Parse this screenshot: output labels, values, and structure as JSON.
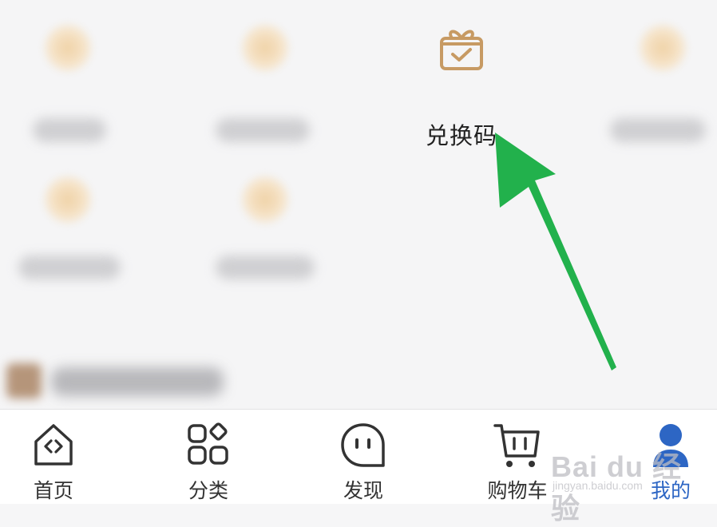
{
  "grid": {
    "redeem_label": "兑换码"
  },
  "tabbar": {
    "tabs": [
      {
        "label": "首页",
        "icon": "home-icon"
      },
      {
        "label": "分类",
        "icon": "category-icon"
      },
      {
        "label": "发现",
        "icon": "discover-chat-icon"
      },
      {
        "label": "购物车",
        "icon": "cart-icon"
      },
      {
        "label": "我的",
        "icon": "user-icon"
      }
    ],
    "active_color": "#2d66c4"
  },
  "watermark": {
    "main": "Bai du 经验",
    "sub": "jingyan.baidu.com"
  },
  "annotation": {
    "arrow_color": "#22b14c"
  }
}
